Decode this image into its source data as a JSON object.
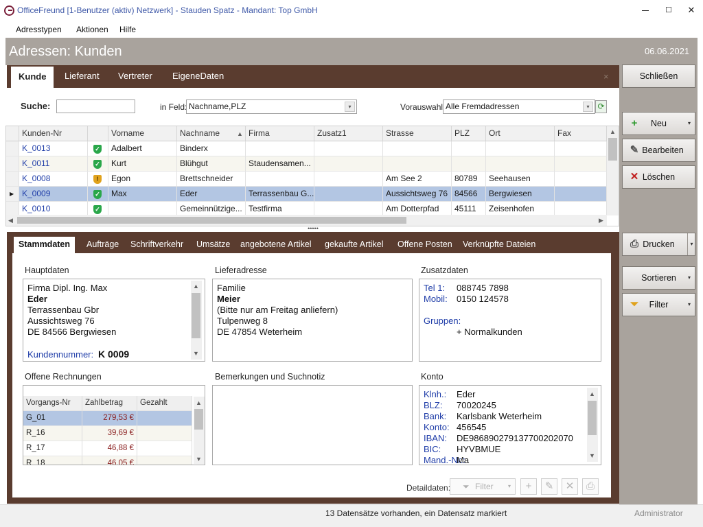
{
  "window": {
    "title": "OfficeFreund [1-Benutzer (aktiv) Netzwerk]  -  Stauden Spatz  -  Mandant: Top GmbH",
    "minimize_icon": "minimize-icon",
    "maximize_icon": "maximize-icon",
    "maximize_glyph": "☐",
    "close_icon": "close-icon",
    "close_glyph": "✕"
  },
  "menu": [
    "Adresstypen",
    "Aktionen",
    "Hilfe"
  ],
  "header": {
    "title": "Adressen: Kunden",
    "date": "06.06.2021"
  },
  "tabs": [
    {
      "label": "Kunde",
      "active": true
    },
    {
      "label": "Lieferant",
      "active": false
    },
    {
      "label": "Vertreter",
      "active": false
    },
    {
      "label": "EigeneDaten",
      "active": false
    }
  ],
  "tabs_close_glyph": "×",
  "search": {
    "label": "Suche:",
    "value": "",
    "field_label": "in Feld:",
    "field_value": "Nachname,PLZ",
    "preselect_label": "Vorauswahl:",
    "preselect_value": "Alle Fremdadressen",
    "dropdown_glyph": "▾",
    "refresh_glyph": "⟳"
  },
  "grid": {
    "columns": [
      "Kunden-Nr",
      "",
      "Vorname",
      "Nachname",
      "Firma",
      "Zusatz1",
      "Strasse",
      "PLZ",
      "Ort",
      "Fax"
    ],
    "sort_glyph": "▲",
    "row_pointer_glyph": "▶",
    "rows": [
      {
        "nr": "K_0013",
        "status": "ok",
        "status_glyph": "✓",
        "vorname": "Adalbert",
        "nachname": "Binderx",
        "firma": "",
        "zusatz1": "",
        "strasse": "",
        "plz": "",
        "ort": "",
        "fax": ""
      },
      {
        "nr": "K_0011",
        "status": "ok",
        "status_glyph": "✓",
        "vorname": "Kurt",
        "nachname": "Blühgut",
        "firma": "Staudensamen...",
        "zusatz1": "",
        "strasse": "",
        "plz": "",
        "ort": "",
        "fax": ""
      },
      {
        "nr": "K_0008",
        "status": "warn",
        "status_glyph": "!",
        "vorname": "Egon",
        "nachname": "Brettschneider",
        "firma": "",
        "zusatz1": "",
        "strasse": "Am See 2",
        "plz": "80789",
        "ort": "Seehausen",
        "fax": ""
      },
      {
        "nr": "K_0009",
        "status": "ok",
        "status_glyph": "✓",
        "vorname": "Max",
        "nachname": "Eder",
        "firma": "Terrassenbau G...",
        "zusatz1": "",
        "strasse": "Aussichtsweg 76",
        "plz": "84566",
        "ort": "Bergwiesen",
        "fax": "",
        "selected": true
      },
      {
        "nr": "K_0010",
        "status": "ok",
        "status_glyph": "✓",
        "vorname": "",
        "nachname": "Gemeinnützige...",
        "firma": "Testfirma",
        "zusatz1": "",
        "strasse": "Am Dotterpfad",
        "plz": "45111",
        "ort": "Zeisenhofen",
        "fax": ""
      }
    ]
  },
  "splitter_glyph": "•••••",
  "detail_tabs": [
    {
      "label": "Stammdaten",
      "active": true
    },
    {
      "label": "Aufträge"
    },
    {
      "label": "Schriftverkehr"
    },
    {
      "label": "Umsätze"
    },
    {
      "label": "angebotene Artikel"
    },
    {
      "label": "gekaufte Artikel"
    },
    {
      "label": "Offene Posten"
    },
    {
      "label": "Verknüpfte Dateien"
    }
  ],
  "hauptdaten": {
    "label": "Hauptdaten",
    "lines": [
      "Firma Dipl. Ing. Max",
      "Eder",
      "Terrassenbau Gbr",
      "Aussichtsweg 76",
      "DE 84566 Bergwiesen"
    ],
    "kundennummer_label": "Kundennummer:",
    "kundennummer_value": "K  0009"
  },
  "lieferadresse": {
    "label": "Lieferadresse",
    "lines": [
      "Familie",
      "Meier",
      "(Bitte nur am Freitag anliefern)",
      "Tulpenweg 8",
      "DE 47854 Weterheim"
    ]
  },
  "zusatzdaten": {
    "label": "Zusatzdaten",
    "tel_label": "Tel 1:",
    "tel_value": "088745 7898",
    "mobil_label": "Mobil:",
    "mobil_value": "0150 124578",
    "gruppen_label": "Gruppen:",
    "gruppen_value": "+  Normalkunden"
  },
  "offene_rechnungen": {
    "label": "Offene Rechnungen",
    "columns": [
      "Vorgangs-Nr",
      "Zahlbetrag",
      "Gezahlt"
    ],
    "rows": [
      {
        "nr": "G_01",
        "betrag": "279,53 €",
        "gezahlt": "",
        "selected": true
      },
      {
        "nr": "R_16",
        "betrag": "39,69 €",
        "gezahlt": ""
      },
      {
        "nr": "R_17",
        "betrag": "46,88 €",
        "gezahlt": ""
      },
      {
        "nr": "R_18",
        "betrag": "46,05 €",
        "gezahlt": ""
      }
    ]
  },
  "bemerkungen": {
    "label": "Bemerkungen und Suchnotiz",
    "text": ""
  },
  "konto": {
    "label": "Konto",
    "rows": [
      {
        "k": "Klnh.:",
        "v": "Eder"
      },
      {
        "k": "BLZ:",
        "v": "70020245"
      },
      {
        "k": "Bank:",
        "v": "Karlsbank Weterheim"
      },
      {
        "k": "Konto:",
        "v": "456545"
      },
      {
        "k": "IBAN:",
        "v": "DE98689027913770020​2070"
      },
      {
        "k": "BIC:",
        "v": "HYVBMUE"
      },
      {
        "k": "Mand.-Nr.:",
        "v": "Ma"
      }
    ]
  },
  "detail_toolbar": {
    "label": "Detaildaten:",
    "filter_label": "Filter"
  },
  "side_buttons": {
    "close": "Schließen",
    "new": "Neu",
    "edit": "Bearbeiten",
    "delete": "Löschen",
    "print": "Drucken",
    "sort": "Sortieren",
    "filter": "Filter"
  },
  "status": {
    "text": "13 Datensätze vorhanden, ein Datensatz markiert",
    "user": "Administrator"
  },
  "colors": {
    "brown": "#5a3c2f",
    "header_gray": "#a9a39d",
    "selection": "#b3c6e3",
    "link_blue": "#1f3da8"
  }
}
